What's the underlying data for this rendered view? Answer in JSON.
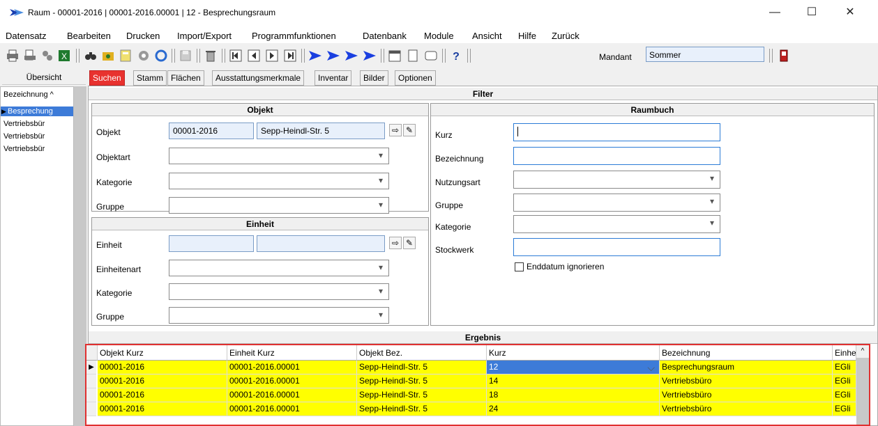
{
  "window": {
    "title": "Raum - 00001-2016 | 00001-2016.00001 | 12 - Besprechungsraum",
    "controls": [
      "—",
      "☐",
      "✕"
    ]
  },
  "menu": [
    "Datensatz",
    "Bearbeiten",
    "Drucken",
    "Import/Export",
    "Programmfunktionen",
    "Datenbank",
    "Module",
    "Ansicht",
    "Hilfe",
    "Zurück"
  ],
  "toolbar": {
    "mandant_label": "Mandant",
    "mandant_value": "Sommer"
  },
  "left": {
    "tab_label": "Übersicht",
    "header": "Bezeichnung",
    "items": [
      "Besprechung",
      "Vertriebsbür",
      "Vertriebsbür",
      "Vertriebsbür"
    ]
  },
  "tabs": [
    "Suchen",
    "Stamm",
    "Flächen",
    "Ausstattungsmerkmale",
    "Inventar",
    "Bilder",
    "Optionen"
  ],
  "filter": {
    "title": "Filter",
    "objekt": {
      "title": "Objekt",
      "objekt_label": "Objekt",
      "objekt_nr": "00001-2016",
      "objekt_name": "Sepp-Heindl-Str. 5",
      "objektart_label": "Objektart",
      "kategorie_label": "Kategorie",
      "gruppe_label": "Gruppe"
    },
    "einheit": {
      "title": "Einheit",
      "einheit_label": "Einheit",
      "einheitenart_label": "Einheitenart",
      "kategorie_label": "Kategorie",
      "gruppe_label": "Gruppe"
    },
    "raumbuch": {
      "title": "Raumbuch",
      "kurz_label": "Kurz",
      "bezeichnung_label": "Bezeichnung",
      "nutzungsart_label": "Nutzungsart",
      "gruppe_label": "Gruppe",
      "kategorie_label": "Kategorie",
      "stockwerk_label": "Stockwerk",
      "enddatum_label": "Enddatum ignorieren"
    }
  },
  "result": {
    "title": "Ergebnis",
    "columns": [
      "Objekt Kurz",
      "Einheit Kurz",
      "Objekt Bez.",
      "Kurz",
      "Bezeichnung",
      "Einhe"
    ],
    "rows": [
      [
        "00001-2016",
        "00001-2016.00001",
        "Sepp-Heindl-Str. 5",
        "12",
        "Besprechungsraum",
        "EGli"
      ],
      [
        "00001-2016",
        "00001-2016.00001",
        "Sepp-Heindl-Str. 5",
        "14",
        "Vertriebsbüro",
        "EGli"
      ],
      [
        "00001-2016",
        "00001-2016.00001",
        "Sepp-Heindl-Str. 5",
        "18",
        "Vertriebsbüro",
        "EGli"
      ],
      [
        "00001-2016",
        "00001-2016.00001",
        "Sepp-Heindl-Str. 5",
        "24",
        "Vertriebsbüro",
        "EGli"
      ]
    ]
  },
  "colors": {
    "active_tab": "#e8322f",
    "row_highlight": "#ffff00",
    "selection": "#3d7bd8",
    "grid_border": "#e03030"
  }
}
